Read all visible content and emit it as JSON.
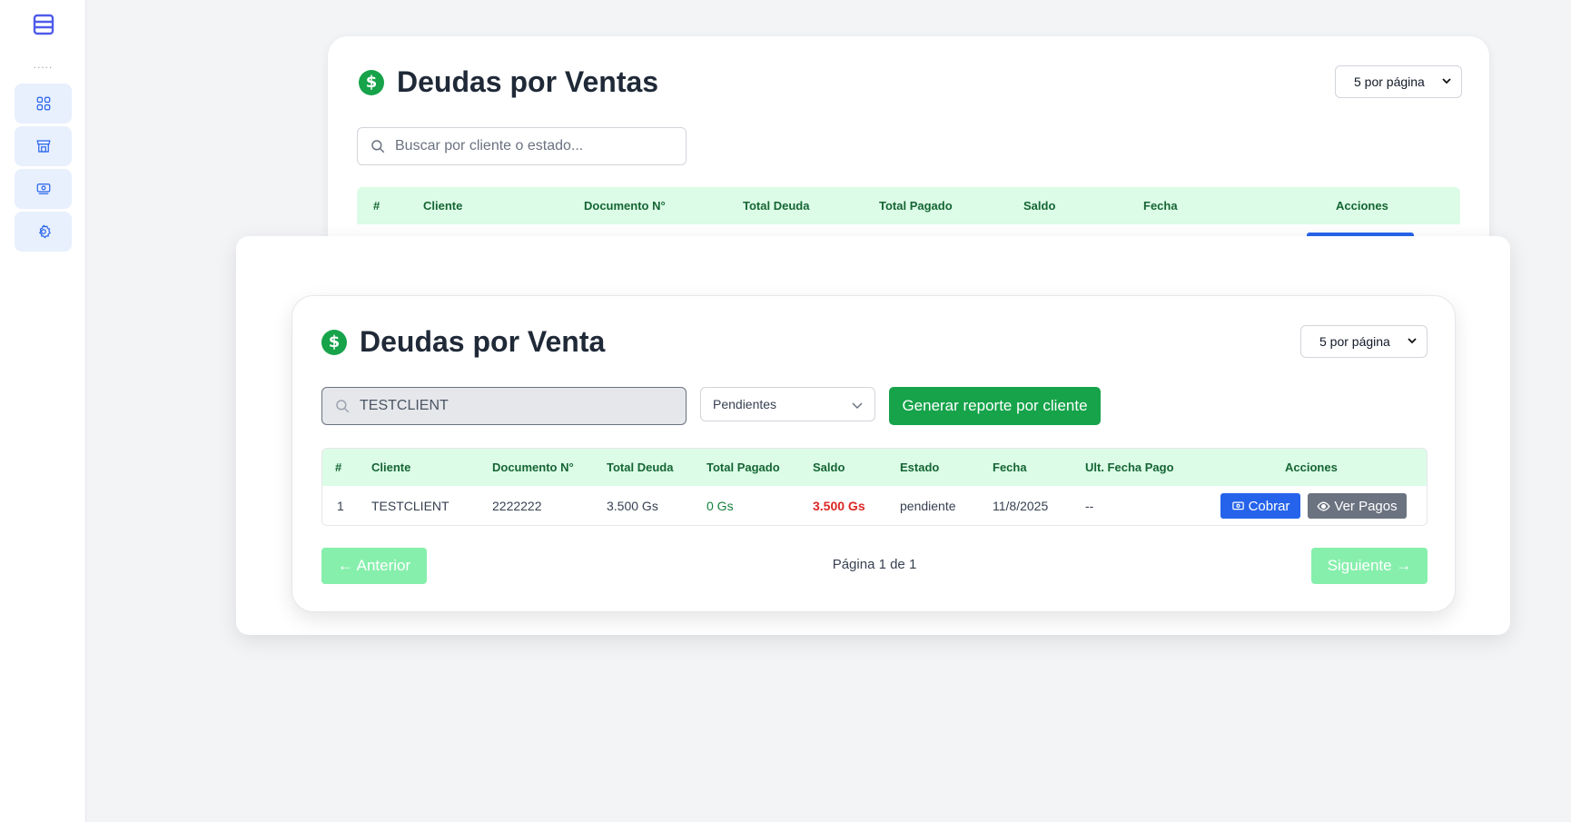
{
  "sidebar": {
    "separator": ".....",
    "items": [
      {
        "icon": "grid-icon"
      },
      {
        "icon": "store-icon"
      },
      {
        "icon": "cash-icon"
      },
      {
        "icon": "gear-icon"
      }
    ]
  },
  "background_card": {
    "title": "Deudas por Ventas",
    "per_page": "5 por página",
    "search_placeholder": "Buscar por cliente o estado...",
    "columns": [
      "#",
      "Cliente",
      "Documento N°",
      "Total Deuda",
      "Total Pagado",
      "Saldo",
      "Fecha",
      "Acciones"
    ]
  },
  "modal": {
    "title": "Deudas por Venta",
    "per_page": "5 por página",
    "search_value": "TESTCLIENT",
    "filter_value": "Pendientes",
    "report_button": "Generar reporte por cliente",
    "columns": [
      "#",
      "Cliente",
      "Documento N°",
      "Total Deuda",
      "Total Pagado",
      "Saldo",
      "Estado",
      "Fecha",
      "Ult. Fecha Pago",
      "Acciones"
    ],
    "rows": [
      {
        "num": "1",
        "cliente": "TESTCLIENT",
        "documento": "2222222",
        "total_deuda": "3.500 Gs",
        "total_pagado": "0 Gs",
        "saldo": "3.500 Gs",
        "estado": "pendiente",
        "fecha": "11/8/2025",
        "ult_fecha_pago": "--",
        "cobrar_label": "Cobrar",
        "ver_pagos_label": "Ver Pagos"
      }
    ],
    "prev_label": "← Anterior",
    "next_label": "Siguiente →",
    "page_info": "Página 1 de 1"
  },
  "colors": {
    "accent_green": "#16a34a",
    "header_green": "#dcfce7",
    "blue": "#2563eb",
    "danger": "#dc2626"
  }
}
